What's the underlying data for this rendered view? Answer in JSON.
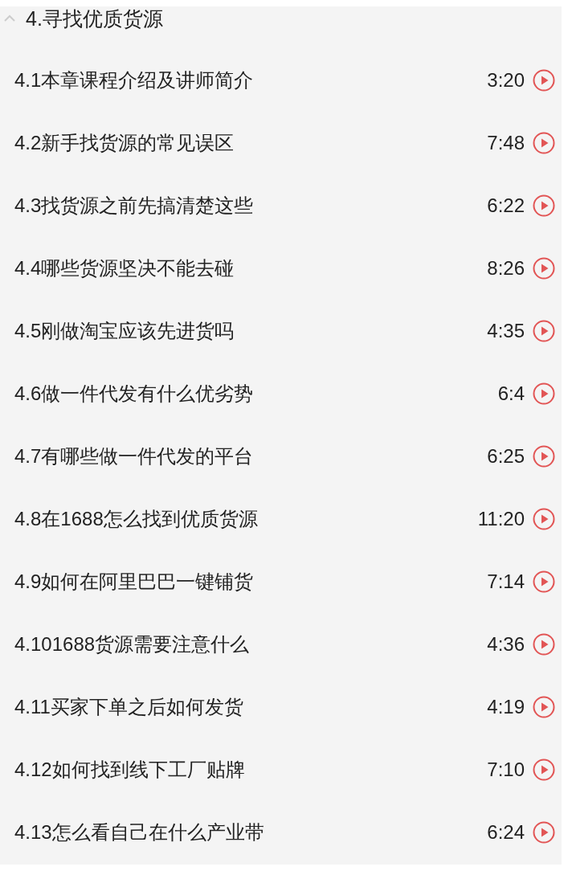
{
  "section": {
    "title": "4.寻找优质货源",
    "expanded": true
  },
  "lessons": [
    {
      "title": "4.1本章课程介绍及讲师简介",
      "duration": "3:20"
    },
    {
      "title": "4.2新手找货源的常见误区",
      "duration": "7:48"
    },
    {
      "title": "4.3找货源之前先搞清楚这些",
      "duration": "6:22"
    },
    {
      "title": "4.4哪些货源坚决不能去碰",
      "duration": "8:26"
    },
    {
      "title": "4.5刚做淘宝应该先进货吗",
      "duration": "4:35"
    },
    {
      "title": "4.6做一件代发有什么优劣势",
      "duration": "6:4"
    },
    {
      "title": "4.7有哪些做一件代发的平台",
      "duration": "6:25"
    },
    {
      "title": "4.8在1688怎么找到优质货源",
      "duration": "11:20"
    },
    {
      "title": "4.9如何在阿里巴巴一键铺货",
      "duration": "7:14"
    },
    {
      "title": "4.101688货源需要注意什么",
      "duration": "4:36"
    },
    {
      "title": "4.11买家下单之后如何发货",
      "duration": "4:19"
    },
    {
      "title": "4.12如何找到线下工厂贴牌",
      "duration": "7:10"
    },
    {
      "title": "4.13怎么看自己在什么产业带",
      "duration": "6:24"
    }
  ]
}
